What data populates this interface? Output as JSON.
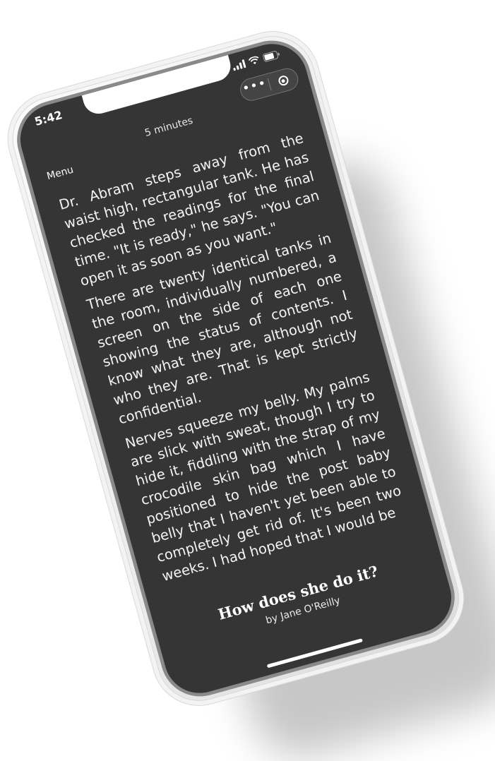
{
  "status_bar": {
    "time": "5:42"
  },
  "capsule": {
    "more_icon": "more-dots-icon",
    "close_icon": "target-close-icon"
  },
  "header": {
    "menu_label": "Menu",
    "reading_time": "5 minutes"
  },
  "story": {
    "paragraphs": [
      "Dr. Abram steps away from the waist high, rectangular tank. He has checked the readings for the final time. \"It is ready,\" he says. \"You can open it as soon as you want.\"",
      "There are twenty identical tanks in the room, individually numbered, a screen on the side of each one showing the status of contents. I know what they are, although not who they are. That is kept strictly confidential.",
      "Nerves squeeze my belly. My palms are slick with sweat, though I try to hide it, fiddling with the strap of my crocodile skin bag which I have positioned to hide the post baby belly that I haven't yet been able to completely get rid of. It's been two weeks. I had hoped that I would be"
    ]
  },
  "book": {
    "title": "How does she do it?",
    "author": "by Jane O'Reilly"
  },
  "colors": {
    "screen_background": "#353535",
    "text": "#f4f4f4",
    "device_frame": "#efefef"
  }
}
